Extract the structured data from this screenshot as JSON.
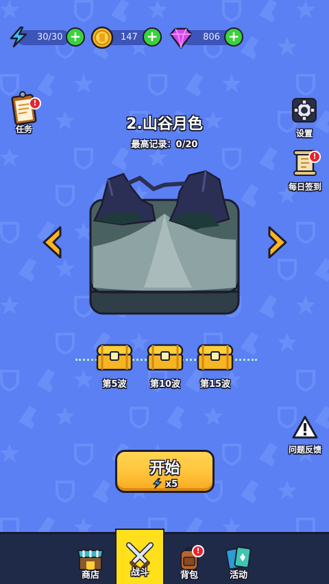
{
  "resources": {
    "energy": {
      "value": "30/30",
      "icon": "lightning-icon"
    },
    "coins": {
      "value": "147",
      "icon": "coin-icon"
    },
    "gems": {
      "value": "806",
      "icon": "gem-icon"
    },
    "plus": "+"
  },
  "side_left": {
    "tasks": {
      "label": "任务",
      "badge": "!"
    }
  },
  "side_right": {
    "settings": {
      "label": "设置"
    },
    "daily_checkin": {
      "label": "每日签到",
      "badge": "!"
    },
    "feedback": {
      "label": "问题反馈"
    }
  },
  "level": {
    "title": "2.山谷月色",
    "best_record": "最高记录：0/20"
  },
  "rewards": [
    {
      "label": "第5波"
    },
    {
      "label": "第10波"
    },
    {
      "label": "第15波"
    }
  ],
  "start_button": {
    "label": "开始",
    "cost": "x5"
  },
  "bottom_nav": [
    {
      "label": "商店",
      "icon": "shop-icon"
    },
    {
      "label": "战斗",
      "icon": "crossed-swords-icon"
    },
    {
      "label": "背包",
      "icon": "backpack-icon",
      "badge": "!"
    },
    {
      "label": "活动",
      "icon": "cards-icon"
    }
  ],
  "colors": {
    "background": "#5b80f4",
    "accent_green": "#3bd13b",
    "badge_red": "#e8232f",
    "button_yellow": "#ffc33a",
    "nav_active": "#ffe01a"
  }
}
